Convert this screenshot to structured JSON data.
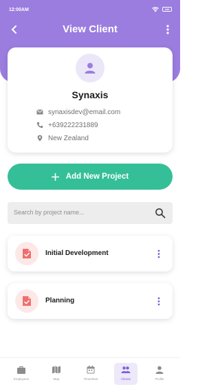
{
  "status_bar": {
    "time": "12:00AM",
    "battery": "100"
  },
  "header": {
    "title": "View Client"
  },
  "client": {
    "name": "Synaxis",
    "email": "synaxisdev@email.com",
    "phone": "+639222231889",
    "location": "New Zealand"
  },
  "actions": {
    "add_project_label": "Add New Project"
  },
  "search": {
    "placeholder": "Search by project name..."
  },
  "projects": [
    {
      "name": "Initial Development"
    },
    {
      "name": "Planning"
    }
  ],
  "nav": [
    {
      "label": "Employees",
      "icon": "briefcase-icon"
    },
    {
      "label": "Map",
      "icon": "map-icon"
    },
    {
      "label": "Timesheet",
      "icon": "calendar-icon"
    },
    {
      "label": "Clients",
      "icon": "people-icon",
      "active": true
    },
    {
      "label": "Profile",
      "icon": "person-icon"
    }
  ],
  "colors": {
    "header": "#9b7de0",
    "accent": "#7e5fd8",
    "add_button": "#35bf98",
    "project_icon": "#ef6f6f"
  }
}
